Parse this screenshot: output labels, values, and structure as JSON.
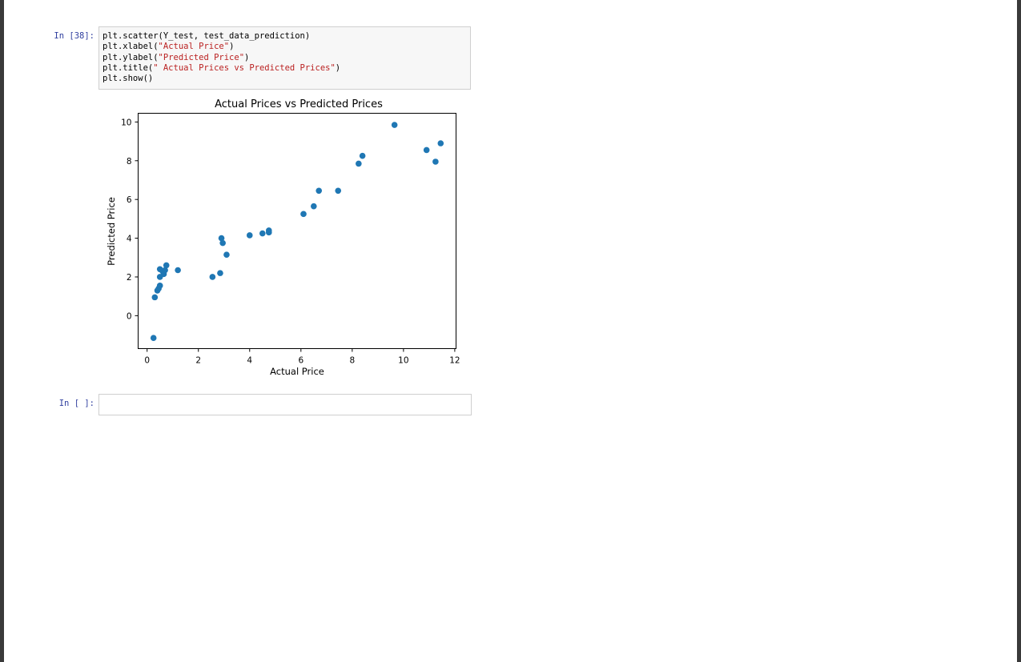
{
  "cells": [
    {
      "prompt": "In [38]:",
      "code": {
        "line1_pre": "plt.scatter(Y_test, test_data_prediction)",
        "line2_pre": "plt.xlabel(",
        "line2_str": "\"Actual Price\"",
        "line2_post": ")",
        "line3_pre": "plt.ylabel(",
        "line3_str": "\"Predicted Price\"",
        "line3_post": ")",
        "line4_pre": "plt.title(",
        "line4_str": "\" Actual Prices vs Predicted Prices\"",
        "line4_post": ")",
        "line5_pre": "plt.show()"
      }
    },
    {
      "prompt": "In [ ]:"
    }
  ],
  "colors": {
    "marker": "#1f77b4",
    "prompt": "#303f9f",
    "string": "#ba2121"
  },
  "chart_data": {
    "type": "scatter",
    "title": "Actual Prices vs Predicted Prices",
    "xlabel": "Actual Price",
    "ylabel": "Predicted Price",
    "xlim": [
      -0.35,
      12.05
    ],
    "ylim": [
      -1.7,
      10.45
    ],
    "xticks": [
      0,
      2,
      4,
      6,
      8,
      10,
      12
    ],
    "yticks": [
      0,
      2,
      4,
      6,
      8,
      10
    ],
    "grid": false,
    "points": [
      {
        "x": 0.25,
        "y": -1.15
      },
      {
        "x": 0.3,
        "y": 0.95
      },
      {
        "x": 0.4,
        "y": 1.3
      },
      {
        "x": 0.45,
        "y": 1.4
      },
      {
        "x": 0.5,
        "y": 1.55
      },
      {
        "x": 0.5,
        "y": 2.0
      },
      {
        "x": 0.5,
        "y": 2.4
      },
      {
        "x": 0.6,
        "y": 2.3
      },
      {
        "x": 0.65,
        "y": 2.15
      },
      {
        "x": 0.7,
        "y": 2.35
      },
      {
        "x": 0.75,
        "y": 2.6
      },
      {
        "x": 1.2,
        "y": 2.35
      },
      {
        "x": 2.55,
        "y": 2.0
      },
      {
        "x": 2.85,
        "y": 2.2
      },
      {
        "x": 2.9,
        "y": 4.0
      },
      {
        "x": 2.95,
        "y": 3.75
      },
      {
        "x": 3.1,
        "y": 3.15
      },
      {
        "x": 4.0,
        "y": 4.15
      },
      {
        "x": 4.5,
        "y": 4.25
      },
      {
        "x": 4.75,
        "y": 4.3
      },
      {
        "x": 4.75,
        "y": 4.4
      },
      {
        "x": 6.1,
        "y": 5.25
      },
      {
        "x": 6.5,
        "y": 5.65
      },
      {
        "x": 6.7,
        "y": 6.45
      },
      {
        "x": 7.45,
        "y": 6.45
      },
      {
        "x": 8.25,
        "y": 7.85
      },
      {
        "x": 8.4,
        "y": 8.25
      },
      {
        "x": 9.65,
        "y": 9.85
      },
      {
        "x": 10.9,
        "y": 8.55
      },
      {
        "x": 11.25,
        "y": 7.95
      },
      {
        "x": 11.45,
        "y": 8.9
      }
    ]
  }
}
